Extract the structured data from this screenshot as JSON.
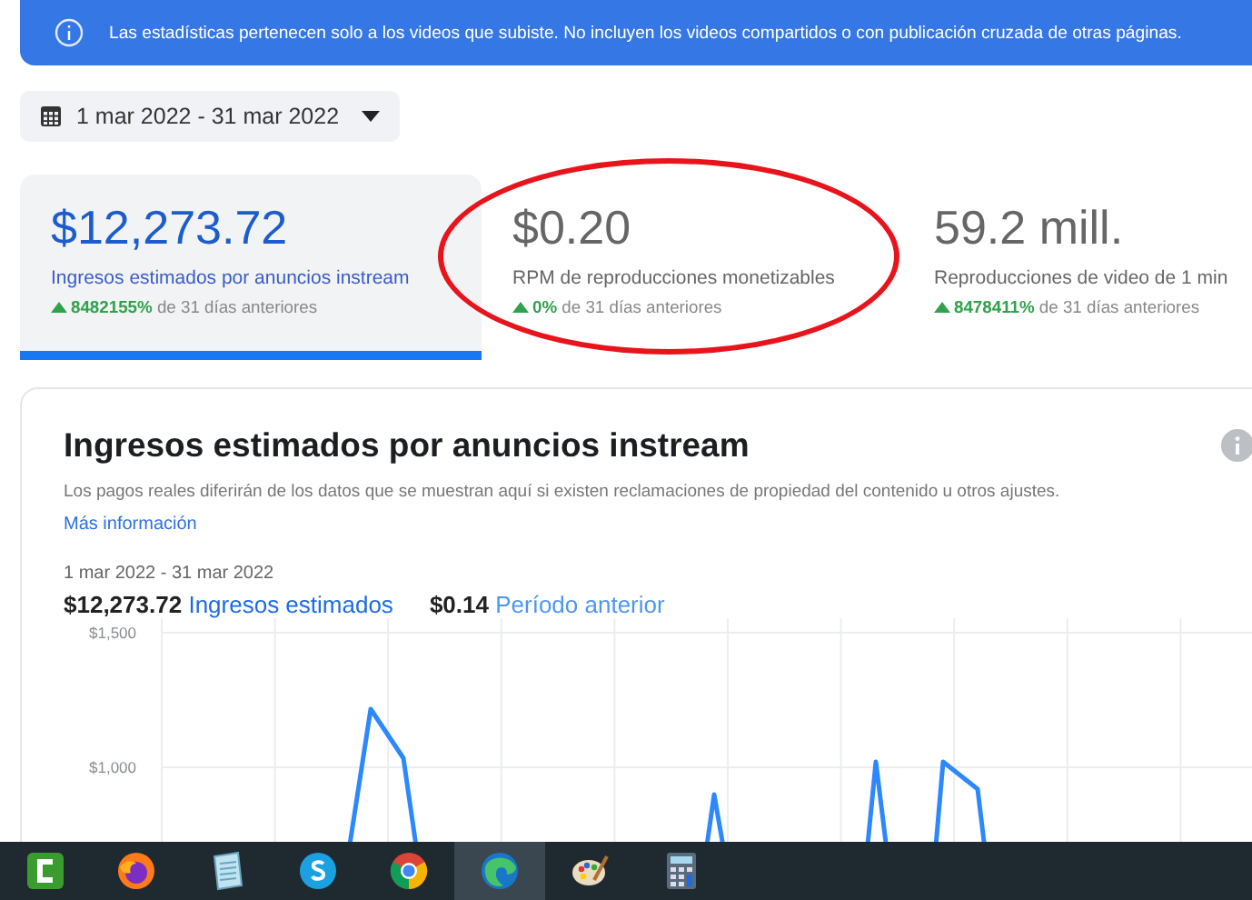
{
  "banner": {
    "text": "Las estadísticas pertenecen solo a los videos que subiste. No incluyen los videos compartidos o con publicación cruzada de otras páginas."
  },
  "date_range": {
    "label": "1 mar 2022 - 31 mar 2022"
  },
  "metrics": [
    {
      "value": "$12,273.72",
      "label": "Ingresos estimados por anuncios instream",
      "change": "8482155%",
      "change_suffix": "de 31 días anteriores",
      "selected": true,
      "circled": false
    },
    {
      "value": "$0.20",
      "label": "RPM de reproducciones monetizables",
      "change": "0%",
      "change_suffix": "de 31 días anteriores",
      "selected": false,
      "circled": true
    },
    {
      "value": "59.2 mill.",
      "label": "Reproducciones de video de 1 min",
      "change": "8478411%",
      "change_suffix": "de 31 días anteriores",
      "selected": false,
      "circled": false
    }
  ],
  "chart_card": {
    "title": "Ingresos estimados por anuncios instream",
    "note": "Los pagos reales diferirán de los datos que se muestran aquí si existen reclamaciones de propiedad del contenido u otros ajustes.",
    "link": "Más información",
    "period": "1 mar 2022 - 31 mar 2022",
    "total_value": "$12,273.72",
    "total_label": "Ingresos estimados",
    "previous_value": "$0.14",
    "previous_label": "Período anterior",
    "y_axis_labels": [
      "$1,500",
      "$1,000"
    ]
  },
  "taskbar": {
    "apps": [
      {
        "kind": "recorder",
        "selected": false
      },
      {
        "kind": "firefox",
        "selected": false
      },
      {
        "kind": "notepad",
        "selected": false
      },
      {
        "kind": "chat",
        "selected": false
      },
      {
        "kind": "chrome",
        "selected": false
      },
      {
        "kind": "edge",
        "selected": true
      },
      {
        "kind": "paint",
        "selected": false
      },
      {
        "kind": "calculator",
        "selected": false
      }
    ]
  }
}
